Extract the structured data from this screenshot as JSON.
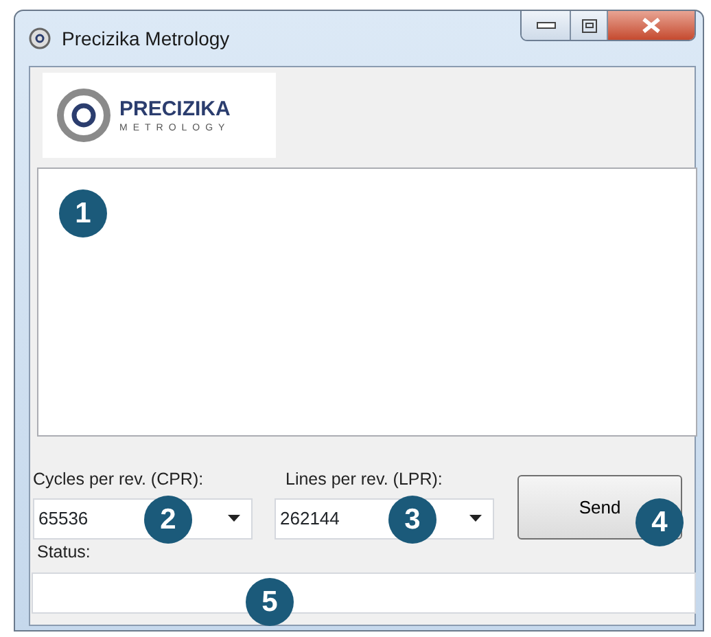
{
  "window": {
    "title": "Precizika Metrology"
  },
  "logo": {
    "name": "PRECIZIKA",
    "subtitle": "METROLOGY"
  },
  "output_area": {
    "callout": "1"
  },
  "cpr": {
    "label": "Cycles per rev. (CPR):",
    "value": "65536",
    "callout": "2"
  },
  "lpr": {
    "label": "Lines per rev. (LPR):",
    "value": "262144",
    "callout": "3"
  },
  "send_button": {
    "label": "Send",
    "callout": "4"
  },
  "status": {
    "label": "Status:",
    "callout": "5"
  }
}
